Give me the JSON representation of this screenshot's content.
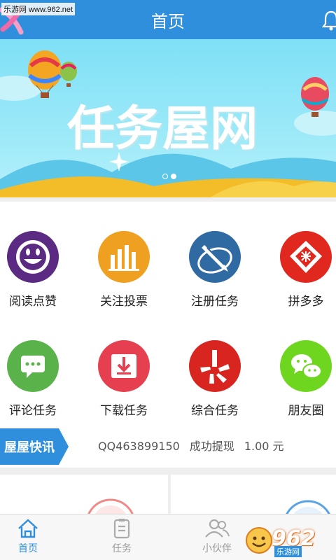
{
  "watermark": {
    "top_left": "乐游网 www.962.net",
    "bottom_right_number": "962",
    "bottom_right_site": "乐游网"
  },
  "header": {
    "title": "首页"
  },
  "banner": {
    "title": "任务屋网"
  },
  "grid": {
    "items": [
      {
        "label": "阅读点赞",
        "icon": "smile-icon",
        "color": "#5b2a83"
      },
      {
        "label": "关注投票",
        "icon": "bar-chart-icon",
        "color": "#f0a020"
      },
      {
        "label": "注册任务",
        "icon": "pen-icon",
        "color": "#2f6aa3"
      },
      {
        "label": "拼多多",
        "icon": "pinduoduo-icon",
        "color": "#e0281f"
      },
      {
        "label": "评论任务",
        "icon": "comment-icon",
        "color": "#5ab34a"
      },
      {
        "label": "下载任务",
        "icon": "download-icon",
        "color": "#e64050"
      },
      {
        "label": "综合任务",
        "icon": "yelp-icon",
        "color": "#d8251f"
      },
      {
        "label": "朋友圈",
        "icon": "wechat-icon",
        "color": "#6fd620"
      }
    ]
  },
  "news": {
    "tag": "屋屋快讯",
    "user": "QQ463899150",
    "action": "成功提现",
    "amount": "1.00 元"
  },
  "bottom_nav": {
    "items": [
      {
        "label": "首页",
        "icon": "home-icon",
        "active": true
      },
      {
        "label": "任务",
        "icon": "task-icon",
        "active": false
      },
      {
        "label": "小伙伴",
        "icon": "friends-icon",
        "active": false
      }
    ]
  },
  "colors": {
    "primary": "#2f8fdc"
  }
}
